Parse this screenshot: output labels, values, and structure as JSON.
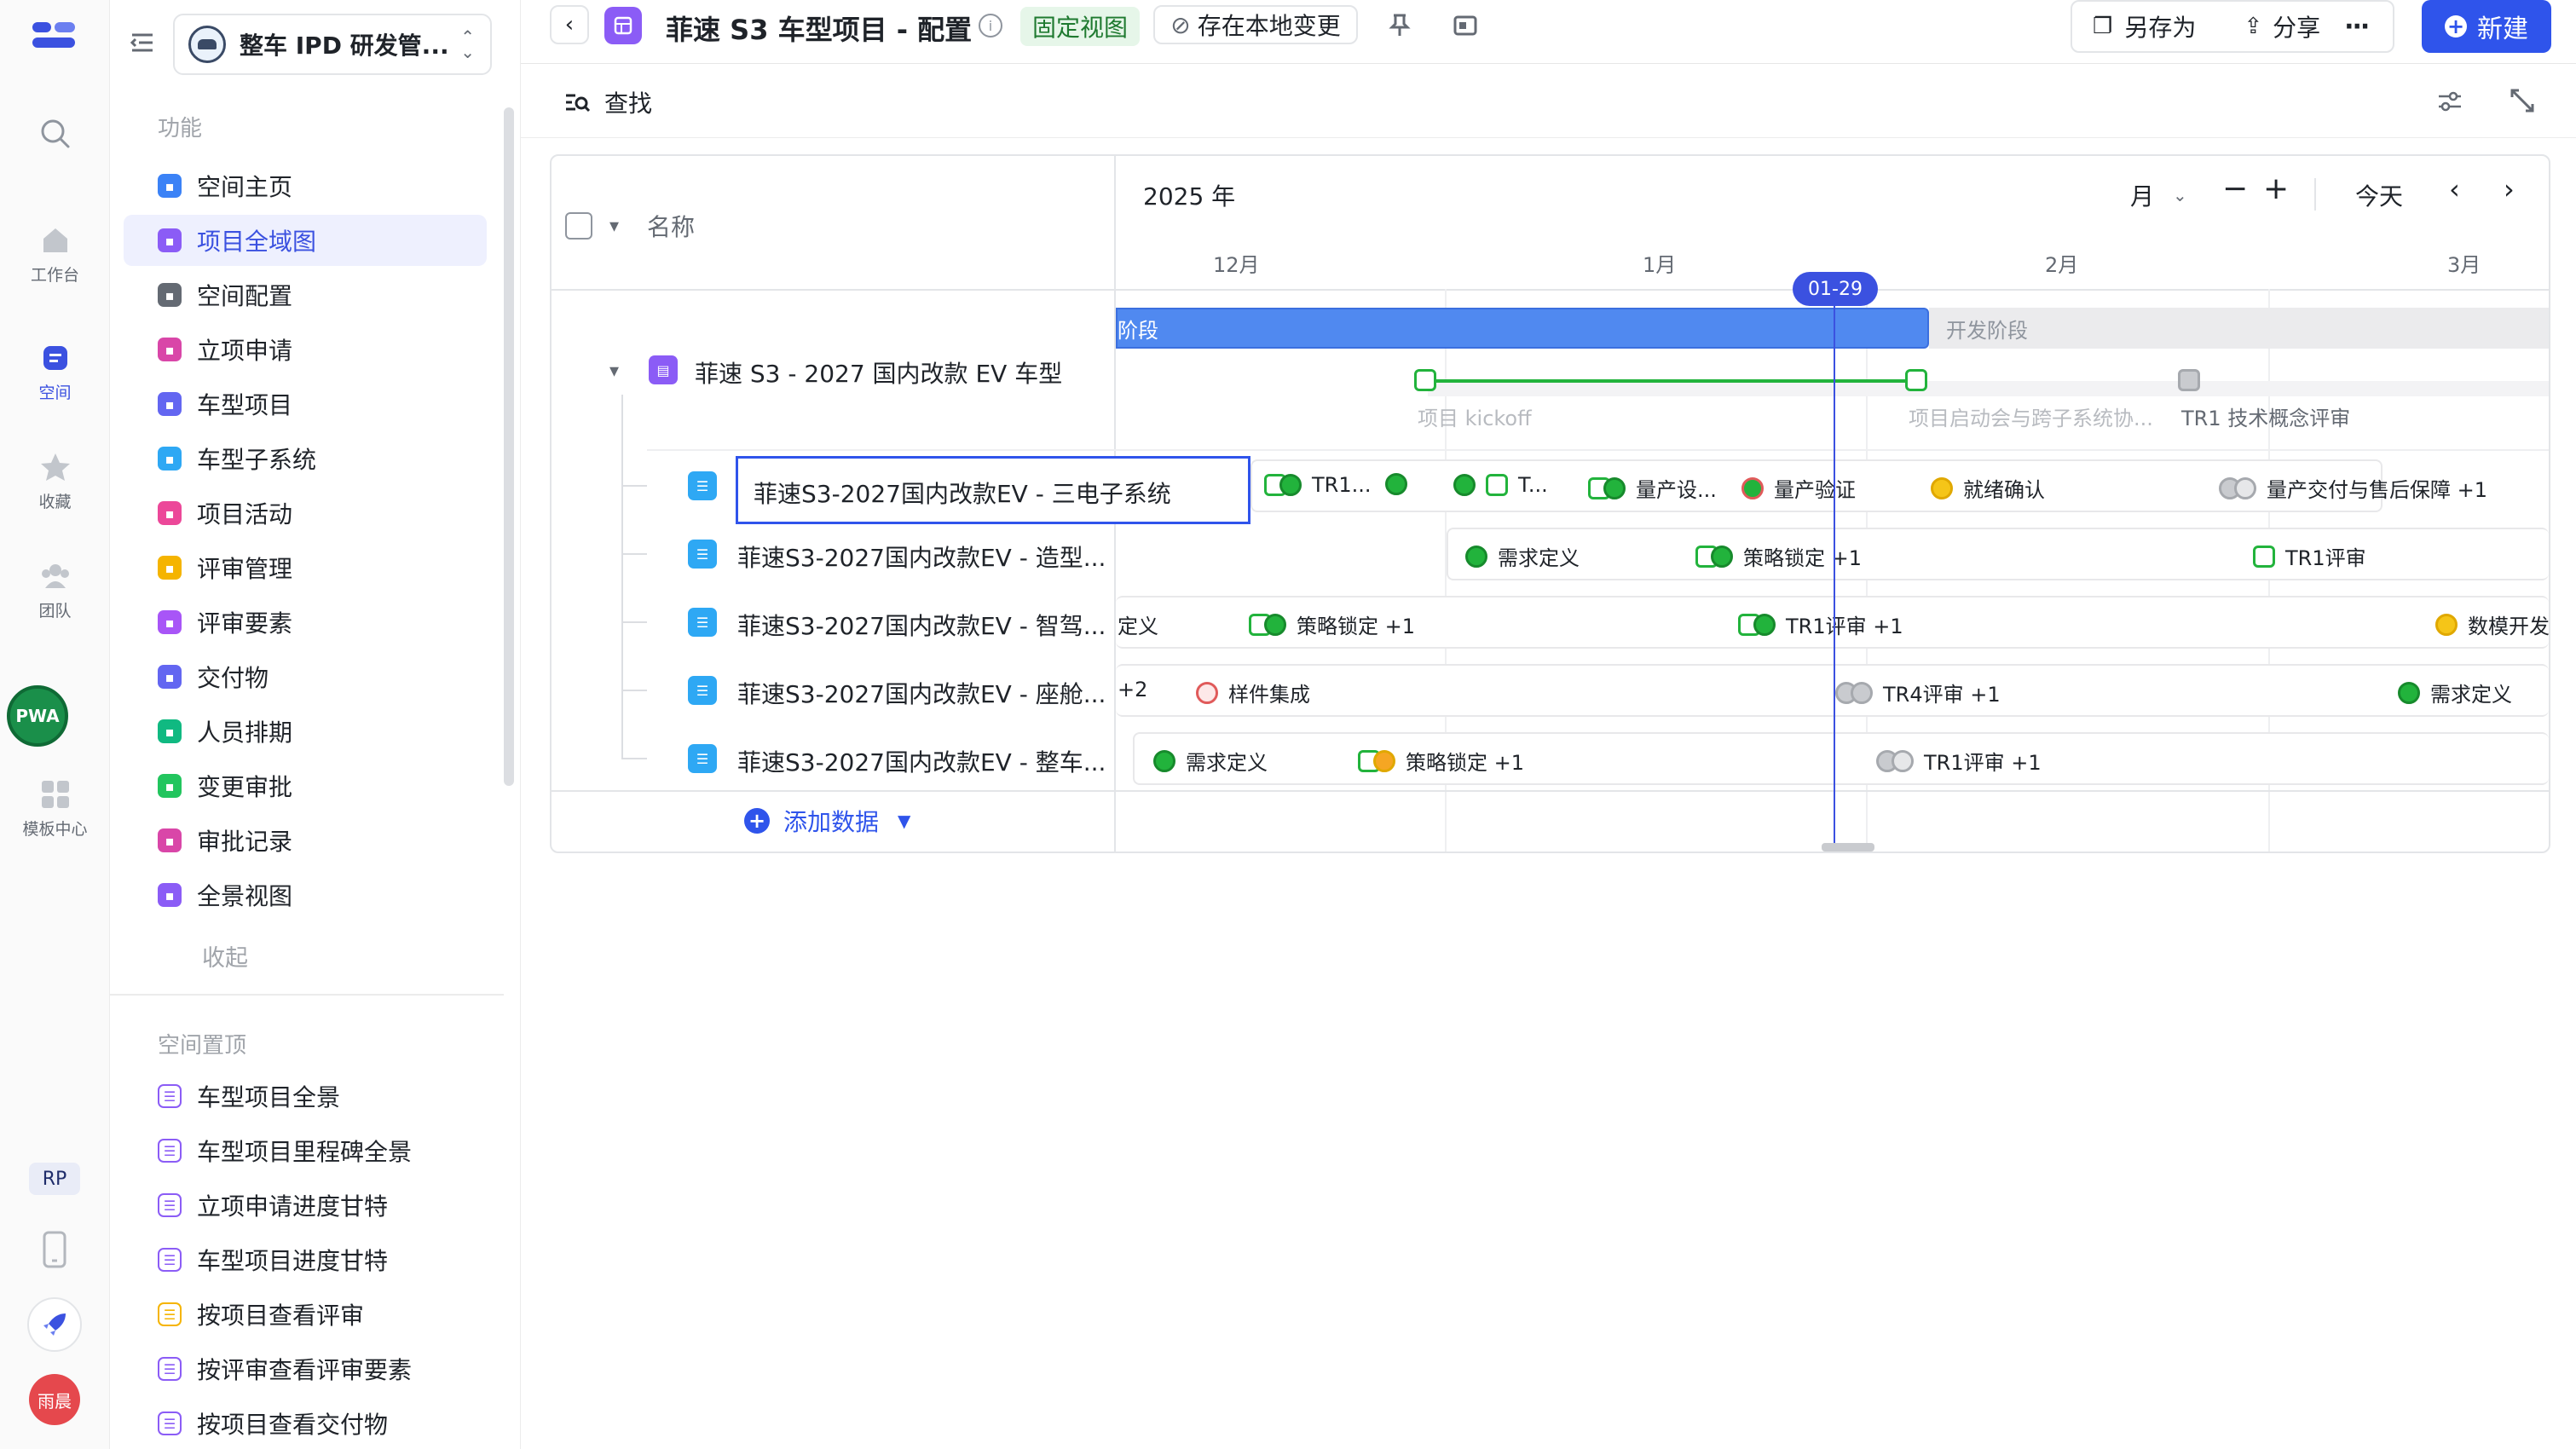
{
  "rail": {
    "items": [
      {
        "label": "工作台",
        "icon": "home-icon"
      },
      {
        "label": "空间",
        "icon": "space-icon"
      },
      {
        "label": "收藏",
        "icon": "star-icon"
      },
      {
        "label": "团队",
        "icon": "team-icon"
      },
      {
        "label": "模板中心",
        "icon": "template-icon"
      }
    ],
    "pwa_badge": "PWA",
    "rp_badge": "RP",
    "user_avatar": "雨晨"
  },
  "workspace": {
    "name": "整车 IPD 研发管..."
  },
  "sidebar": {
    "section_features": "功能",
    "features": [
      {
        "label": "空间主页",
        "color": "#3b82f6",
        "active": false
      },
      {
        "label": "项目全域图",
        "color": "#8b5cf6",
        "active": true
      },
      {
        "label": "空间配置",
        "color": "#646a73",
        "active": false
      },
      {
        "label": "立项申请",
        "color": "#d946a8",
        "active": false
      },
      {
        "label": "车型项目",
        "color": "#6366f1",
        "active": false
      },
      {
        "label": "车型子系统",
        "color": "#2ea8f4",
        "active": false
      },
      {
        "label": "项目活动",
        "color": "#ec4899",
        "active": false
      },
      {
        "label": "评审管理",
        "color": "#f5b400",
        "active": false
      },
      {
        "label": "评审要素",
        "color": "#a855f7",
        "active": false
      },
      {
        "label": "交付物",
        "color": "#6366f1",
        "active": false
      },
      {
        "label": "人员排期",
        "color": "#10b981",
        "active": false
      },
      {
        "label": "变更审批",
        "color": "#22c55e",
        "active": false
      },
      {
        "label": "审批记录",
        "color": "#d946a8",
        "active": false
      },
      {
        "label": "全景视图",
        "color": "#8b5cf6",
        "active": false
      }
    ],
    "collapse": "收起",
    "section_pinned": "空间置顶",
    "pinned": [
      {
        "label": "车型项目全景",
        "color": "#8b5cf6"
      },
      {
        "label": "车型项目里程碑全景",
        "color": "#8b5cf6"
      },
      {
        "label": "立项申请进度甘特",
        "color": "#8b5cf6"
      },
      {
        "label": "车型项目进度甘特",
        "color": "#8b5cf6"
      },
      {
        "label": "按项目查看评审",
        "color": "#f5b400"
      },
      {
        "label": "按评审查看评审要素",
        "color": "#8b5cf6"
      },
      {
        "label": "按项目查看交付物",
        "color": "#8b5cf6"
      }
    ]
  },
  "header": {
    "title": "菲速 S3 车型项目 - 配置",
    "fixed_view": "固定视图",
    "save_local": "存在本地变更",
    "save_as": "另存为",
    "share": "分享",
    "new": "新建"
  },
  "toolbar": {
    "find": "查找"
  },
  "gantt": {
    "name_header": "名称",
    "year": "2025 年",
    "scale": "月",
    "today": "今天",
    "months": [
      "12月",
      "1月",
      "2月",
      "3月"
    ],
    "today_marker": "01-29",
    "parent_row": "菲速 S3 - 2027 国内改款 EV 车型",
    "phase1": "阶段",
    "phase2": "开发阶段",
    "parent_milestones": [
      "项目 kickoff",
      "项目启动会与跨子系统协...",
      "TR1 技术概念评审"
    ],
    "rows": [
      "菲速S3-2027国内改款EV - 三电子系统",
      "菲速S3-2027国内改款EV - 造型...",
      "菲速S3-2027国内改款EV - 智驾...",
      "菲速S3-2027国内改款EV - 座舱...",
      "菲速S3-2027国内改款EV - 整车..."
    ],
    "row1_ms": [
      "TR1...",
      "T...",
      "量产设...",
      "量产验证",
      "就绪确认",
      "量产交付与售后保障 +1"
    ],
    "row2_ms": [
      "需求定义",
      "策略锁定 +1",
      "TR1评审"
    ],
    "row3_ms": [
      "定义",
      "策略锁定 +1",
      "TR1评审 +1",
      "数模开发"
    ],
    "row4_ms": [
      "+2",
      "样件集成",
      "TR4评审 +1",
      "需求定义"
    ],
    "row5_ms": [
      "需求定义",
      "策略锁定 +1",
      "TR1评审 +1"
    ],
    "add_data": "添加数据"
  }
}
